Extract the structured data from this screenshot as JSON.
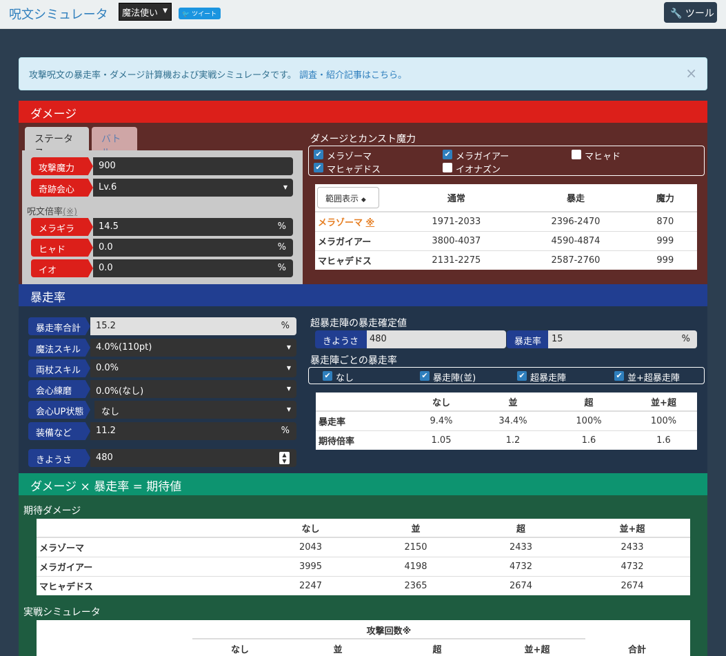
{
  "navbar": {
    "brand": "呪文シミュレータ",
    "class_select": "魔法使い",
    "tweet": "ツイート",
    "tool": "ツール"
  },
  "alert": {
    "text": "攻撃呪文の暴走率・ダメージ計算機および実戦シミュレータです。",
    "link": "調査・紹介記事はこちら。",
    "close": "×"
  },
  "damage": {
    "title": "ダメージ",
    "tabs": [
      "ステータス",
      "バトル"
    ],
    "attack_power_label": "攻撃魔力",
    "attack_power_value": "900",
    "miracle_label": "奇跡会心",
    "miracle_value": "Lv.6",
    "spell_mult_label": "呪文倍率",
    "spell_mult_note": "(※)",
    "multipliers": [
      {
        "label": "メラギラ",
        "value": "14.5",
        "unit": "%"
      },
      {
        "label": "ヒャド",
        "value": "0.0",
        "unit": "%"
      },
      {
        "label": "イオ",
        "value": "0.0",
        "unit": "%"
      }
    ],
    "const_title": "ダメージとカンスト魔力",
    "spell_checks": [
      {
        "label": "メラゾーマ",
        "checked": true
      },
      {
        "label": "メラガイアー",
        "checked": true
      },
      {
        "label": "マヒャド",
        "checked": false
      },
      {
        "label": "マヒャデドス",
        "checked": true
      },
      {
        "label": "イオナズン",
        "checked": false
      }
    ],
    "table": {
      "range_button": "範囲表示",
      "headers": [
        "通常",
        "暴走",
        "魔力"
      ],
      "rows": [
        {
          "name": "メラゾーマ",
          "note": "※",
          "normal": "1971-2033",
          "runaway": "2396-2470",
          "power": "870"
        },
        {
          "name": "メラガイアー",
          "note": "",
          "normal": "3800-4037",
          "runaway": "4590-4874",
          "power": "999"
        },
        {
          "name": "マヒャデドス",
          "note": "",
          "normal": "2131-2275",
          "runaway": "2587-2760",
          "power": "999"
        }
      ]
    }
  },
  "rate": {
    "title": "暴走率",
    "total_label": "暴走率合計",
    "total_value": "15.2",
    "magic_skill_label": "魔法スキル",
    "magic_skill_value": "4.0%(110pt)",
    "dual_staff_label": "両杖スキル",
    "dual_staff_value": "0.0%",
    "crit_train_label": "会心練磨",
    "crit_train_value": "0.0%(なし)",
    "crit_up_label": "会心UP状態",
    "crit_up_value": "なし",
    "equip_label": "装備など",
    "equip_value": "11.2",
    "dex_label": "きようさ",
    "dex_value": "480",
    "unit": "%",
    "super_title": "超暴走陣の暴走確定値",
    "super_dex_label": "きようさ",
    "super_dex_value": "480",
    "super_rate_label": "暴走率",
    "super_rate_value": "15",
    "array_title": "暴走陣ごとの暴走率",
    "array_checks": [
      "なし",
      "暴走陣(並)",
      "超暴走陣",
      "並+超暴走陣"
    ],
    "table": {
      "headers": [
        "なし",
        "並",
        "超",
        "並+超"
      ],
      "rows": [
        {
          "name": "暴走率",
          "values": [
            "9.4%",
            "34.4%",
            "100%",
            "100%"
          ]
        },
        {
          "name": "期待倍率",
          "values": [
            "1.05",
            "1.2",
            "1.6",
            "1.6"
          ]
        }
      ]
    }
  },
  "expected": {
    "title": "ダメージ × 暴走率 = 期待値",
    "exp_damage_title": "期待ダメージ",
    "table": {
      "headers": [
        "なし",
        "並",
        "超",
        "並+超"
      ],
      "rows": [
        {
          "name": "メラゾーマ",
          "values": [
            "2043",
            "2150",
            "2433",
            "2433"
          ]
        },
        {
          "name": "メラガイアー",
          "values": [
            "3995",
            "4198",
            "4732",
            "4732"
          ]
        },
        {
          "name": "マヒャデドス",
          "values": [
            "2247",
            "2365",
            "2674",
            "2674"
          ]
        }
      ]
    },
    "sim_title": "実戦シミュレータ",
    "sim_table": {
      "group_header": "攻撃回数※",
      "headers": [
        "なし",
        "並",
        "超",
        "並+超"
      ],
      "total": "合計"
    }
  }
}
